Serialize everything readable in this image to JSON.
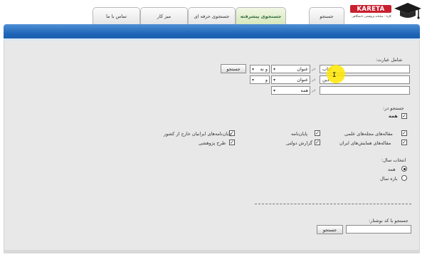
{
  "logo": {
    "name": "KARETA",
    "tagline": "کارتا - سامانه پژوهشی دانشگاهی"
  },
  "tabs": [
    {
      "label": "جستجو"
    },
    {
      "label": "جستجوی پیشرفته"
    },
    {
      "label": "جستجوی حرفه ای"
    },
    {
      "label": "میز کار"
    },
    {
      "label": "تماس با ما"
    }
  ],
  "form": {
    "phrase_label": "شامل عبارت:",
    "rows": [
      {
        "value": "کتاب",
        "in_label": "در",
        "field": "عنوان",
        "operator": "و نه"
      },
      {
        "value": "دین",
        "in_label": "در",
        "field": "عنوان",
        "operator": "و"
      },
      {
        "value": "",
        "in_label": "در",
        "field": "همه",
        "operator": ""
      }
    ],
    "search_button": "جستجو",
    "search_in_label": "جستجو در:",
    "all_label": "همه",
    "sources": {
      "journal_articles": "مقاله‌های مجله‌های علمی",
      "theses": "پایان‌نامه",
      "foreign_theses": "پایان‌نامه‌های ایرانیان خارج از کشور",
      "conference_articles": "مقاله‌های همایش‌های ایران",
      "gov_reports": "گزارش دولتی",
      "research_projects": "طرح پژوهشی"
    },
    "year_label": "انتخاب سال:",
    "year_options": {
      "all": "همه",
      "range": "بازه سال"
    },
    "code_label": "جستجو با کد نوشتار:",
    "code_button": "جستجو"
  }
}
